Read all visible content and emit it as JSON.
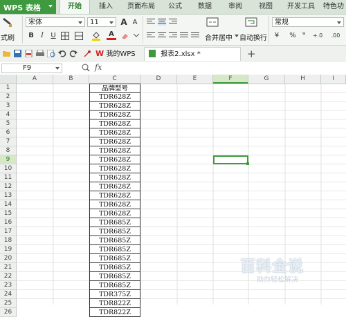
{
  "app": {
    "name": "WPS 表格"
  },
  "menu": [
    "开始",
    "插入",
    "页面布局",
    "公式",
    "数据",
    "审阅",
    "视图",
    "开发工具",
    "特色功"
  ],
  "ribbon": {
    "paste_label": "式刷",
    "font_name": "宋体",
    "font_size": "11",
    "grow_font": "A",
    "shrink_font": "A",
    "bold": "B",
    "italic": "I",
    "underline": "U",
    "font_color": "A",
    "merge_center": "合并居中",
    "wrap_text": "自动换行",
    "number_format": "常规",
    "currency": "¥",
    "percent": "%",
    "comma": "⁹",
    "inc_decimal": "+.0",
    "dec_decimal": ".00"
  },
  "tabs": [
    {
      "label": "我的WPS"
    },
    {
      "label": "报表2.xlsx *"
    }
  ],
  "formula_bar": {
    "name_box": "F9",
    "fx": "fx",
    "value": ""
  },
  "columns": [
    "A",
    "B",
    "C",
    "D",
    "E",
    "F",
    "G",
    "H",
    "I"
  ],
  "selected_column": "F",
  "selected_row": "9",
  "rows": [
    {
      "n": "1",
      "c": "品牌型号"
    },
    {
      "n": "2",
      "c": "TDR628Z"
    },
    {
      "n": "3",
      "c": "TDR628Z"
    },
    {
      "n": "4",
      "c": "TDR628Z"
    },
    {
      "n": "5",
      "c": "TDR628Z"
    },
    {
      "n": "6",
      "c": "TDR628Z"
    },
    {
      "n": "7",
      "c": "TDR628Z"
    },
    {
      "n": "8",
      "c": "TDR628Z"
    },
    {
      "n": "9",
      "c": "TDR628Z"
    },
    {
      "n": "10",
      "c": "TDR628Z"
    },
    {
      "n": "11",
      "c": "TDR628Z"
    },
    {
      "n": "12",
      "c": "TDR628Z"
    },
    {
      "n": "13",
      "c": "TDR628Z"
    },
    {
      "n": "14",
      "c": "TDR628Z"
    },
    {
      "n": "15",
      "c": "TDR628Z"
    },
    {
      "n": "16",
      "c": "TDR685Z"
    },
    {
      "n": "17",
      "c": "TDR685Z"
    },
    {
      "n": "18",
      "c": "TDR685Z"
    },
    {
      "n": "19",
      "c": "TDR685Z"
    },
    {
      "n": "20",
      "c": "TDR685Z"
    },
    {
      "n": "21",
      "c": "TDR685Z"
    },
    {
      "n": "22",
      "c": "TDR685Z"
    },
    {
      "n": "23",
      "c": "TDR685Z"
    },
    {
      "n": "24",
      "c": "TDR375Z"
    },
    {
      "n": "25",
      "c": "TDR822Z"
    },
    {
      "n": "26",
      "c": "TDR822Z"
    }
  ],
  "watermark": {
    "title": "百科全说",
    "subtitle": "助你轻松解决"
  },
  "colors": {
    "accent": "#3f9a3f",
    "menu_bg": "#d8e4d8"
  }
}
